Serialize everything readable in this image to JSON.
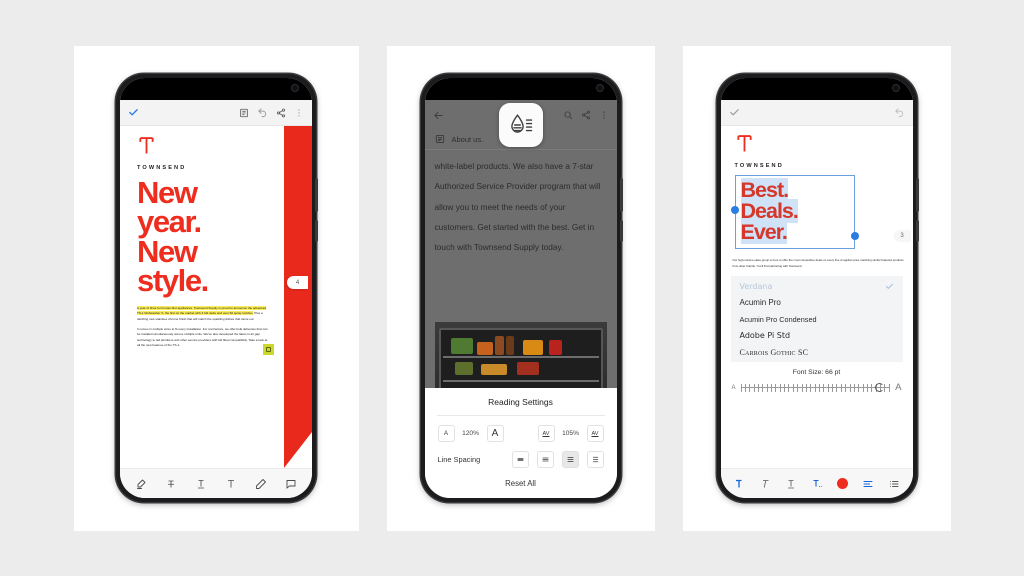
{
  "background_color": "#ececec",
  "brand": {
    "name": "TOWNSEND",
    "red": "#ee2d1e",
    "accent_blue": "#1565d8"
  },
  "phone1": {
    "name": "markup-editor-screen",
    "appbar": {
      "confirm_icon": "checkmark-icon",
      "note_icon": "note-icon",
      "undo_icon": "undo-icon",
      "share_icon": "share-icon",
      "more_icon": "more-vertical-icon"
    },
    "document": {
      "logo_word": "TOWNSEND",
      "headline_lines": [
        "New",
        "year.",
        "New",
        "style."
      ],
      "paragraph_highlighted": "A year of firsts for human-first appliances. Townsend Supply is proud to announce the advanced TS-1 Dishwasher X, the first on the market with 4 full racks and over 60 spray nozzles.",
      "paragraph_highlighted_tail": " Plus a dazzling new stainless chrome finish that will match the sparkling dishes that came out.",
      "paragraph_2": "It comes in multiple sizes to fit every installation. For contractors, we offer bulk deliveries that can be installed simultaneously across multiple units. We've also developed the latest in air gap technology to aid plumbers and other service providers with full fitted compatibility. Take a look at all the new features of the TS-1.",
      "page_number": "4",
      "highlight_color": "#fbec5a",
      "band_color": "#e8291c"
    },
    "toolbar": [
      {
        "label": "Highlighter",
        "icon": "highlighter-icon"
      },
      {
        "label": "Strikethrough",
        "icon": "strikethrough-text-icon"
      },
      {
        "label": "Underline",
        "icon": "underline-text-icon"
      },
      {
        "label": "Text",
        "icon": "text-icon"
      },
      {
        "label": "Draw",
        "icon": "pen-icon"
      },
      {
        "label": "Comment",
        "icon": "comment-icon"
      }
    ]
  },
  "phone2": {
    "name": "reading-settings-screen",
    "app_icon": "droplet-lines-icon",
    "appbar": {
      "back_icon": "back-arrow-icon",
      "search_icon": "search-icon",
      "share_icon": "share-icon",
      "more_icon": "more-vertical-icon"
    },
    "section": {
      "icon": "list-icon",
      "label": "About us."
    },
    "reader_text": "white-label products. We also have a 7-star Authorized Service Provider program that will allow you to meet the needs of your customers. Get started with the best. Get in touch with Townsend Supply today.",
    "sheet": {
      "title": "Reading Settings",
      "font_size": {
        "decrease_label": "A",
        "value": "120%",
        "increase_label": "A"
      },
      "letter_spacing": {
        "decrease_label": "AV",
        "value": "105%",
        "increase_label": "AV"
      },
      "line_spacing_label": "Line Spacing",
      "line_spacing_options": [
        "tight",
        "normal",
        "relaxed",
        "loose"
      ],
      "line_spacing_selected_index": 2,
      "reset_label": "Reset All"
    }
  },
  "phone3": {
    "name": "font-picker-screen",
    "appbar": {
      "confirm_icon": "checkmark-icon",
      "undo_icon": "undo-icon"
    },
    "document": {
      "logo_word": "TOWNSEND",
      "selected_headline": [
        "Best.",
        "Deals.",
        "Ever."
      ],
      "small_paragraph": "Our high-volume sales group is here to offer the most competitive deals on every line of applian price matching similar featured products from other brands. You'll find partnering with Townsend",
      "page_number": "3"
    },
    "font_list": [
      {
        "name": "Verdana",
        "selected": true
      },
      {
        "name": "Acumin Pro",
        "selected": false
      },
      {
        "name": "Acumin Pro Condensed",
        "selected": false
      },
      {
        "name": "Adobe Pi Std",
        "selected": false
      },
      {
        "name": "Carrois Gothic SC",
        "selected": false
      }
    ],
    "font_size_label": "Font Size: 66 pt",
    "slider": {
      "min_label": "A",
      "max_label": "A"
    },
    "toolbar": [
      {
        "label": "Bold",
        "icon": "bold-text-icon",
        "active": true
      },
      {
        "label": "Italic",
        "icon": "italic-text-icon",
        "active": false
      },
      {
        "label": "Underline",
        "icon": "underline-text-icon",
        "active": false
      },
      {
        "label": "Text Style",
        "icon": "text-style-icon",
        "active": true
      },
      {
        "label": "Color",
        "icon": "color-swatch-icon",
        "active": false
      },
      {
        "label": "Align",
        "icon": "align-left-icon",
        "active": true
      },
      {
        "label": "List",
        "icon": "bullet-list-icon",
        "active": false
      }
    ]
  }
}
